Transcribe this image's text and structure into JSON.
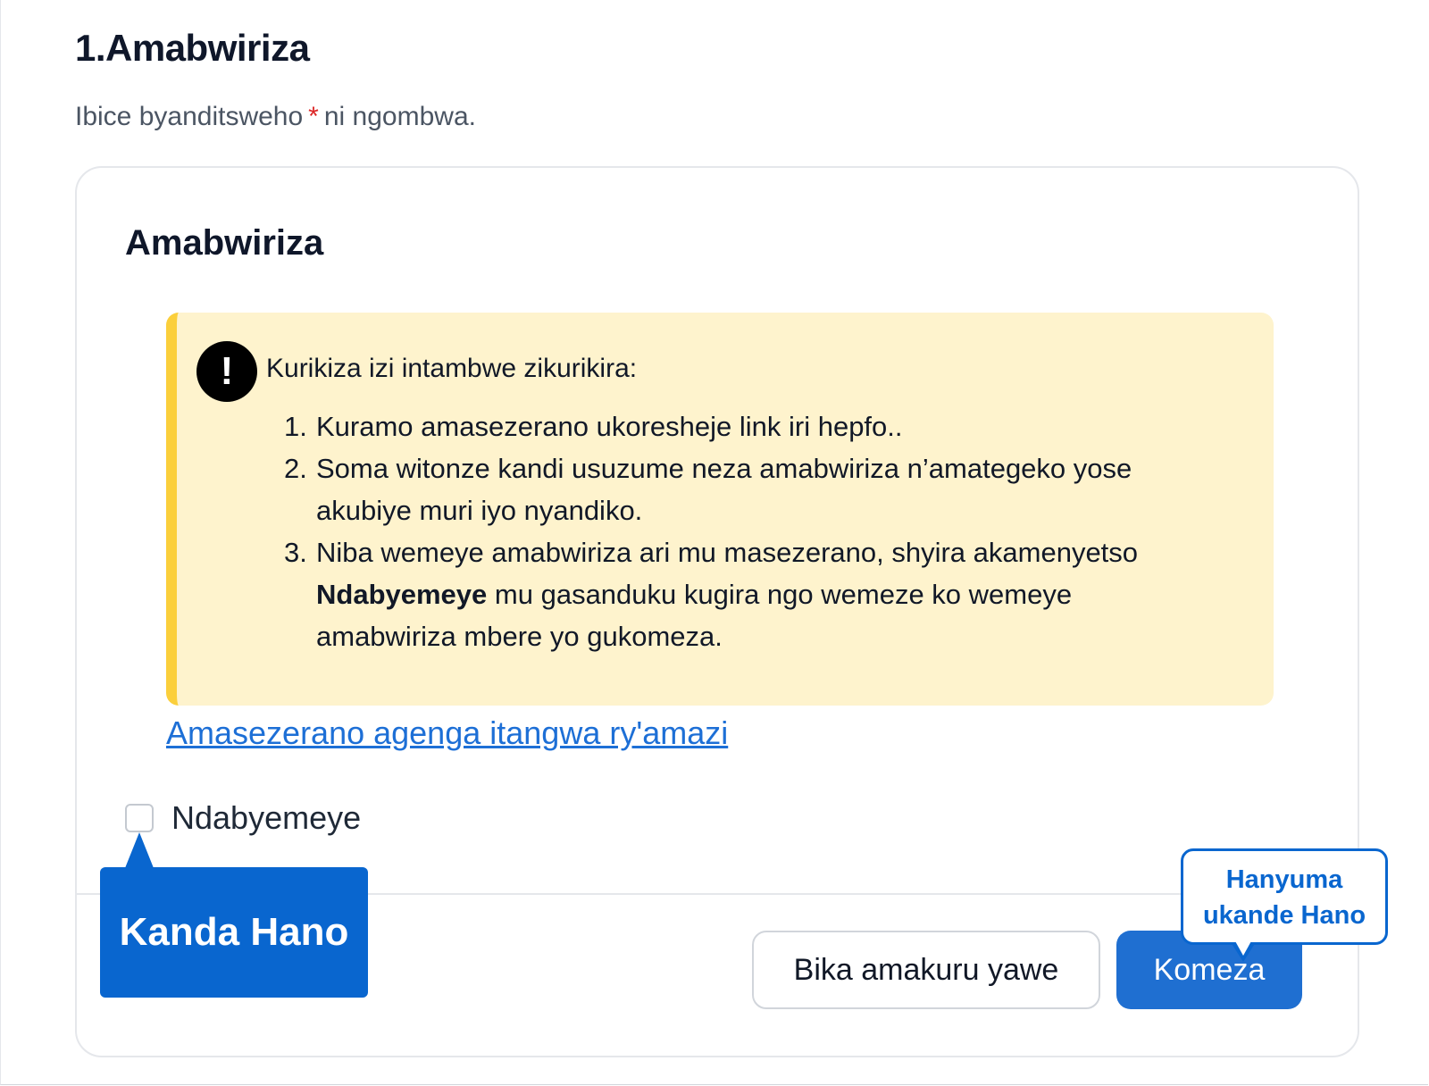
{
  "section": {
    "title": "1.Amabwiriza",
    "required_note_prefix": "Ibice byanditsweho",
    "required_marker": "*",
    "required_note_suffix": "ni ngombwa."
  },
  "card": {
    "title": "Amabwiriza",
    "notice": {
      "icon": "exclamation-icon",
      "heading": "Kurikiza izi intambwe zikurikira:",
      "steps": [
        {
          "number": "1.",
          "text": "Kuramo amasezerano ukoresheje link iri hepfo.."
        },
        {
          "number": "2.",
          "text": "Soma witonze kandi usuzume neza amabwiriza n’amategeko yose akubiye muri iyo nyandiko."
        },
        {
          "number": "3.",
          "text_before": "Niba wemeye amabwiriza ari mu masezerano, shyira akamenyetso",
          "strong": "Ndabyemeye",
          "text_after": "mu gasanduku kugira ngo wemeze ko wemeye amabwiriza mbere yo gukomeza."
        }
      ]
    },
    "agreement_link": "Amasezerano agenga itangwa ry'amazi",
    "checkbox_label": "Ndabyemeye",
    "checkbox_checked": false,
    "buttons": {
      "save": "Bika amakuru yawe",
      "continue": "Komeza"
    }
  },
  "annotations": {
    "left_callout": "Kanda Hano",
    "right_callout_line1": "Hanyuma",
    "right_callout_line2": "ukande Hano"
  },
  "colors": {
    "primary": "#1f6fd1",
    "callout": "#0966cf",
    "notice_bg": "#fef3cd",
    "notice_border": "#fbcf3b",
    "required_star": "#dc2626",
    "link": "#1d6fd6"
  }
}
